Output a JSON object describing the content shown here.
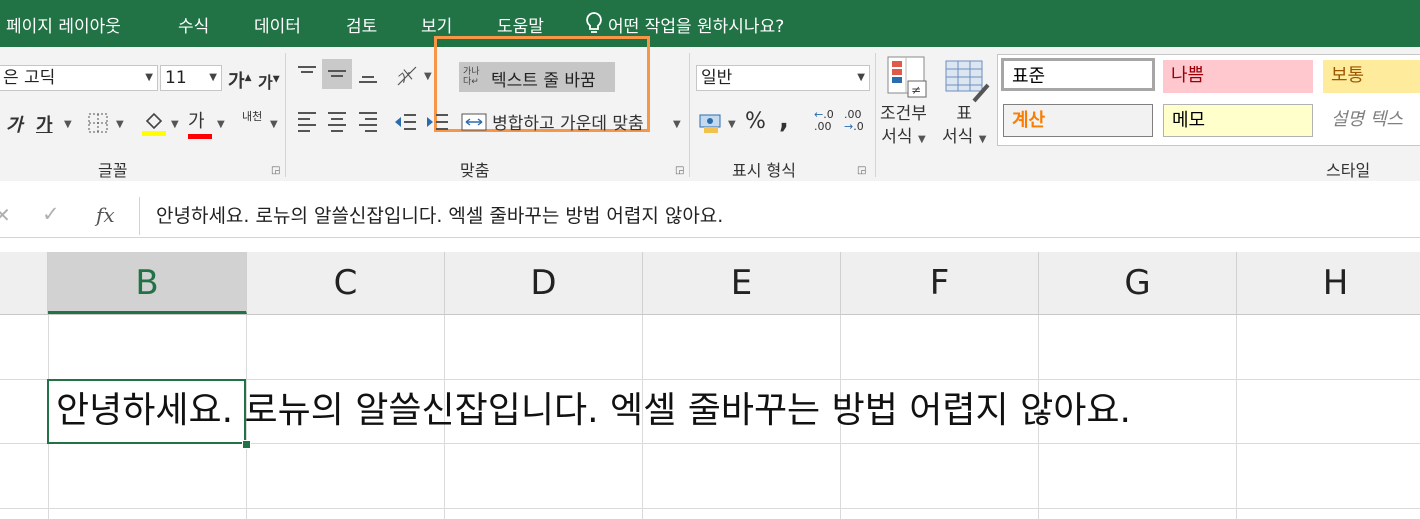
{
  "menu": [
    "페이지 레이아웃",
    "수식",
    "데이터",
    "검토",
    "보기",
    "도움말"
  ],
  "tell_me": "어떤 작업을 원하시나요?",
  "font": {
    "name": "은 고딕",
    "size": "11",
    "grow": "가",
    "shrink": "가",
    "italic": "가",
    "underline": "가",
    "font_color": "가",
    "phonetic": "내천",
    "group_label": "글꼴"
  },
  "alignment": {
    "wrap_text": "텍스트 줄 바꿈",
    "merge_center": "병합하고 가운데 맞춤",
    "group_label": "맞춤"
  },
  "number": {
    "format": "일반",
    "percent": "%",
    "comma": ",",
    "inc_decimal": ".00",
    "dec_decimal": ".0",
    "group_label": "표시 형식"
  },
  "styles": {
    "conditional_line1": "조건부",
    "conditional_line2": "서식",
    "table_line1": "표",
    "table_line2": "서식",
    "cells": [
      {
        "label": "표준",
        "bg": "#ffffff",
        "color": "#000000"
      },
      {
        "label": "나쁨",
        "bg": "#ffc7ce",
        "color": "#9c0006"
      },
      {
        "label": "보통",
        "bg": "#ffeb9c",
        "color": "#9c5700"
      },
      {
        "label": "계산",
        "bg": "#f2f2f2",
        "color": "#fa7d00"
      },
      {
        "label": "메모",
        "bg": "#ffffcc",
        "color": "#000000"
      },
      {
        "label": "설명 텍스",
        "bg": "#ffffff",
        "color": "#7f7f7f"
      }
    ],
    "group_label": "스타일"
  },
  "formula_bar": {
    "fx": "fx",
    "content": "안녕하세요. 로뉴의 알쓸신잡입니다. 엑셀 줄바꾸는 방법 어렵지 않아요."
  },
  "grid": {
    "columns": [
      "B",
      "C",
      "D",
      "E",
      "F",
      "G",
      "H"
    ],
    "active_column": "B",
    "cell_text": "안녕하세요. 로뉴의 알쓸신잡입니다. 엑셀 줄바꾸는 방법 어렵지 않아요."
  },
  "colors": {
    "excel_green": "#217346",
    "highlight_box": "#f79646"
  }
}
